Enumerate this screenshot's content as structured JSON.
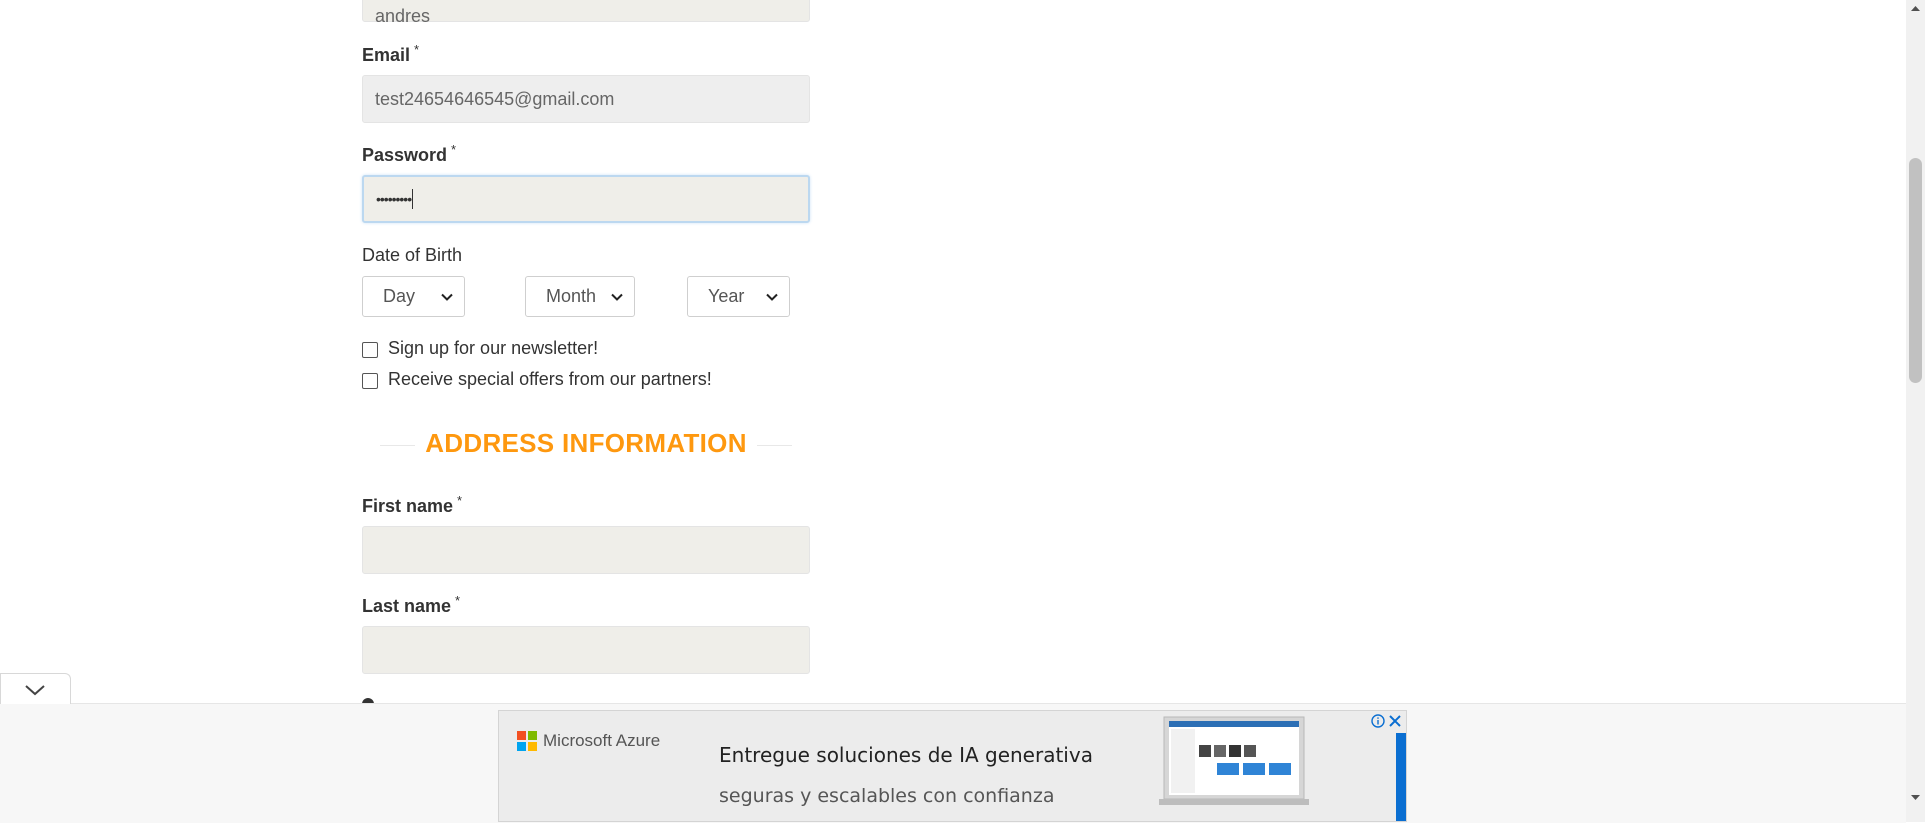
{
  "form": {
    "name_value_partial": "andres",
    "email_label": "Email",
    "email_value": "test24654646545@gmail.com",
    "password_label": "Password",
    "password_value": "•••••••••",
    "required_mark": "*",
    "dob_label": "Date of Birth",
    "day_selected": "Day",
    "month_selected": "Month",
    "year_selected": "Year",
    "newsletter_label": "Sign up for our newsletter!",
    "offers_label": "Receive special offers from our partners!"
  },
  "address": {
    "section_title": "ADDRESS INFORMATION",
    "first_name_label": "First name",
    "last_name_label": "Last name"
  },
  "ad": {
    "brand": "Microsoft Azure",
    "headline": "Entregue soluciones de IA generativa",
    "subline": "seguras y escalables con confianza"
  },
  "colors": {
    "accent": "#fe980f",
    "input_bg": "#efeee9",
    "ad_blue": "#0a6ed1"
  },
  "icons": [
    "chevron-down-icon",
    "info-icon",
    "close-icon",
    "microsoft-logo-icon"
  ]
}
